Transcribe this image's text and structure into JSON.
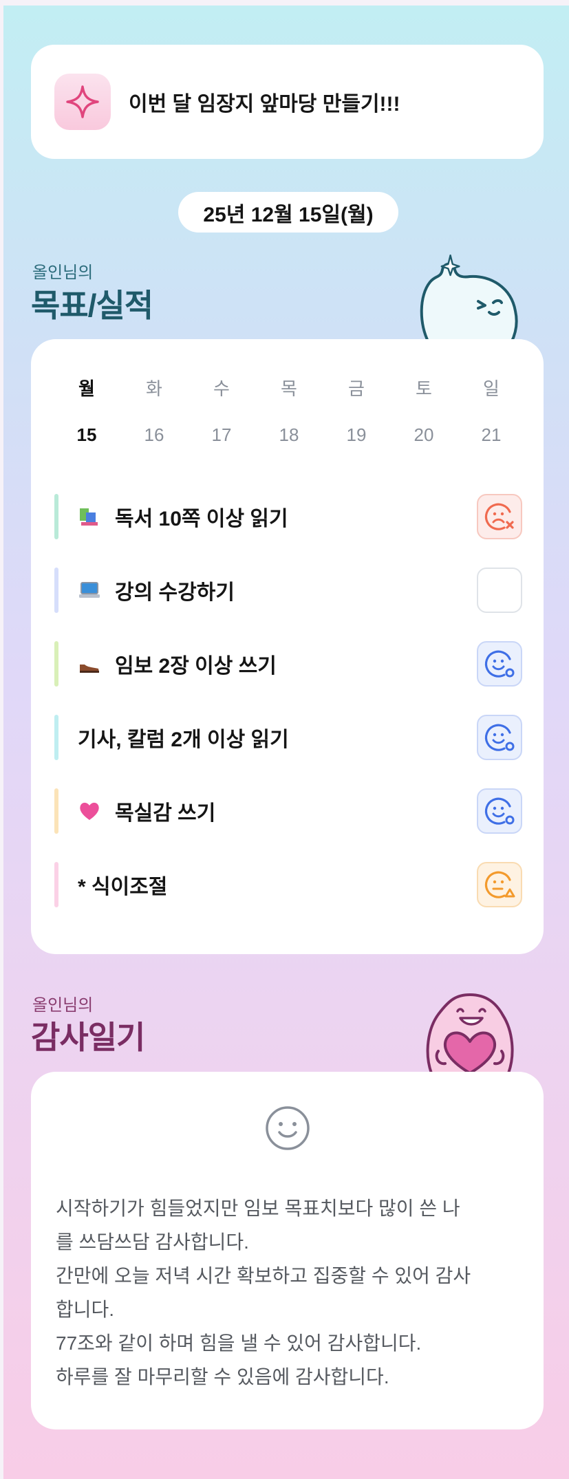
{
  "banner": {
    "text": "이번 달 임장지 앞마당 만들기!!!",
    "icon": "sparkle-icon"
  },
  "date": "25년 12월 15일(월)",
  "goals_section": {
    "owner": "올인님의",
    "title": "목표/실적",
    "title_color": "#1f5a6a"
  },
  "week": {
    "weekdays": [
      "월",
      "화",
      "수",
      "목",
      "금",
      "토",
      "일"
    ],
    "days": [
      "15",
      "16",
      "17",
      "18",
      "19",
      "20",
      "21"
    ],
    "selected_index": 0
  },
  "goals": [
    {
      "label": "독서 10쪽 이상 읽기",
      "emoji": "books-icon",
      "bar_color": "#b9ead8",
      "status": "failed",
      "status_color": "#f06a4f"
    },
    {
      "label": "강의 수강하기",
      "emoji": "laptop-icon",
      "bar_color": "#d6defb",
      "status": "empty",
      "status_color": "#dfe3e8"
    },
    {
      "label": "임보 2장 이상 쓰기",
      "emoji": "shoe-icon",
      "bar_color": "#d9f0b8",
      "status": "done",
      "status_color": "#3f6fe6"
    },
    {
      "label": "기사, 칼럼 2개 이상 읽기",
      "emoji": "",
      "bar_color": "#bfeef1",
      "status": "done",
      "status_color": "#3f6fe6"
    },
    {
      "label": "목실감 쓰기",
      "emoji": "heart-icon",
      "bar_color": "#fbe3b8",
      "status": "done",
      "status_color": "#3f6fe6"
    },
    {
      "label": "* 식이조절",
      "emoji": "",
      "bar_color": "#fbd1e6",
      "status": "partial",
      "status_color": "#f39a2c"
    }
  ],
  "diary_section": {
    "owner": "올인님의",
    "title": "감사일기",
    "title_color": "#7a2d63"
  },
  "diary": {
    "icon": "smile-icon",
    "text": "시작하기가 힘들었지만 임보 목표치보다 많이 쓴 나\n를 쓰담쓰담 감사합니다.\n간만에 오늘 저녁 시간 확보하고 집중할 수 있어 감사\n합니다.\n77조와 같이 하며 힘을 낼 수 있어 감사합니다.\n하루를 잘 마무리할 수 있음에 감사합니다."
  }
}
